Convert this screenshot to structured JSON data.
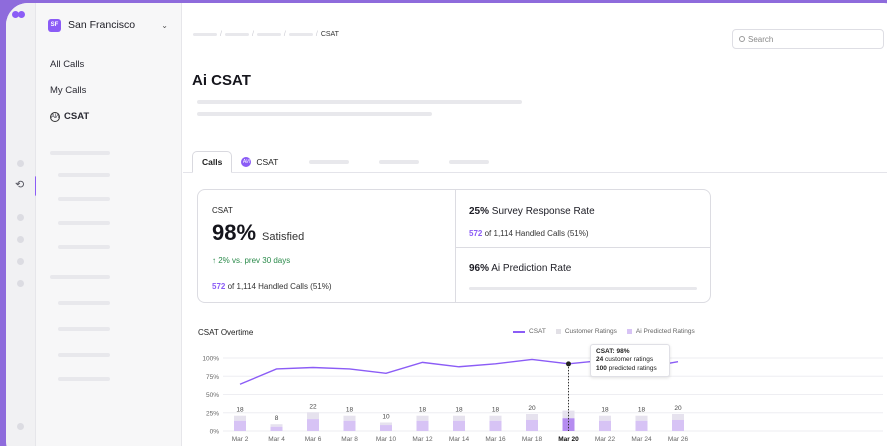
{
  "sidebar": {
    "workspace_initials": "SF",
    "workspace_name": "San Francisco",
    "nav_all_calls": "All Calls",
    "nav_my_calls": "My Calls",
    "nav_csat": "CSAT",
    "csat_icon_glyph": "АИ"
  },
  "header": {
    "breadcrumb_current": "CSAT",
    "search_placeholder": "Search"
  },
  "page": {
    "title": "Ai CSAT"
  },
  "tabs": {
    "calls": "Calls",
    "csat": "CSAT"
  },
  "summary": {
    "csat_label": "CSAT",
    "csat_value": "98%",
    "csat_text": "Satisfied",
    "delta": "↑ 2% vs. prev 30 days",
    "handled_count": "572",
    "handled_text": "of 1,114 Handled Calls (51%)",
    "survey_pct": "25%",
    "survey_text": "Survey Response Rate",
    "survey_count": "572",
    "survey_sub": "of 1,114 Handled Calls (51%)",
    "prediction_pct": "96%",
    "prediction_text": "Ai Prediction Rate"
  },
  "chart": {
    "title": "CSAT Overtime",
    "legend_csat": "CSAT",
    "legend_customer": "Customer Ratings",
    "legend_predicted": "Ai Predicted Ratings",
    "tooltip": {
      "title": "CSAT: 98%",
      "customer_count": "24",
      "customer_text": "customer ratings",
      "predicted_count": "100",
      "predicted_text": "predicted ratings"
    }
  },
  "colors": {
    "accent": "#8b5cf6",
    "bar_customer": "#e6e2ee",
    "bar_predicted": "#d7c3f5",
    "bar_selected": "#b58cf0"
  },
  "chart_data": {
    "type": "bar",
    "categories": [
      "Mar 2",
      "Mar 4",
      "Mar 6",
      "Mar 8",
      "Mar 10",
      "Mar 12",
      "Mar 14",
      "Mar 16",
      "Mar 18",
      "Mar 20",
      "Mar 22",
      "Mar 24",
      "Mar 26"
    ],
    "selected_category": "Mar 20",
    "bar_labels": [
      "18",
      "8",
      "22",
      "18",
      "10",
      "18",
      "18",
      "18",
      "20",
      "",
      "18",
      "18",
      "20"
    ],
    "series": [
      {
        "name": "CSAT",
        "type": "line",
        "values": [
          64,
          85,
          87,
          85,
          79,
          94,
          88,
          92,
          98,
          92,
          97,
          86,
          95
        ]
      },
      {
        "name": "Customer Ratings",
        "type": "bar",
        "values": [
          18,
          8,
          22,
          18,
          10,
          18,
          18,
          18,
          20,
          24,
          18,
          18,
          20
        ]
      },
      {
        "name": "Ai Predicted Ratings",
        "type": "bar",
        "values": [
          12,
          5,
          14,
          12,
          7,
          12,
          12,
          12,
          13,
          15,
          12,
          12,
          13
        ]
      }
    ],
    "y_tick_labels": [
      "100%",
      "75%",
      "50%",
      "25%",
      "0%"
    ],
    "ylim": [
      0,
      100
    ],
    "legend_position": "top-right",
    "grid": true
  }
}
